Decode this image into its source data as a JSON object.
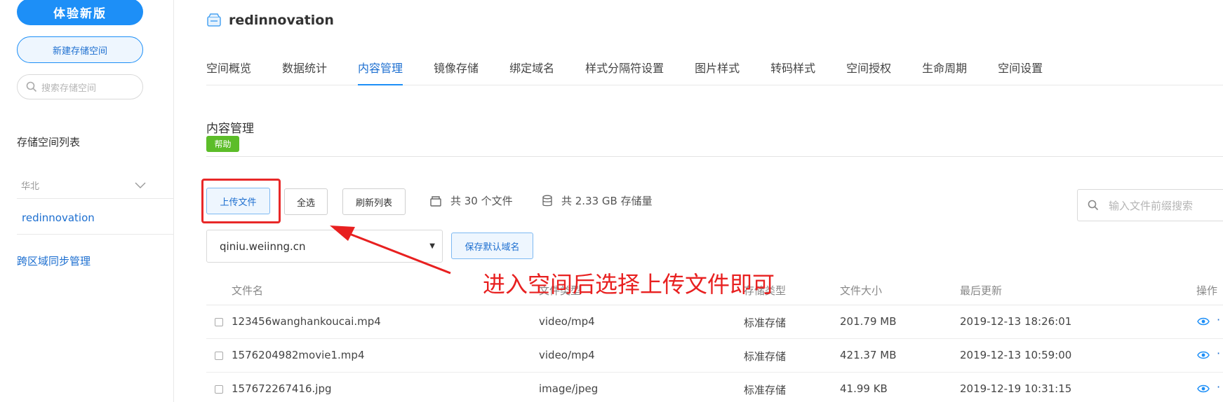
{
  "colors": {
    "primary": "#1d8ff7",
    "link": "#1d6fd0",
    "help": "#5cbd29",
    "annotation": "#e82020"
  },
  "sidebar": {
    "new_version": "体验新版",
    "new_space": "新建存储空间",
    "search_placeholder": "搜索存储空间",
    "list_title": "存储空间列表",
    "region": "华北",
    "space": "redinnovation",
    "sync": "跨区域同步管理"
  },
  "header": {
    "bucket_name": "redinnovation"
  },
  "tabs": [
    "空间概览",
    "数据统计",
    "内容管理",
    "镜像存储",
    "绑定域名",
    "样式分隔符设置",
    "图片样式",
    "转码样式",
    "空间授权",
    "生命周期",
    "空间设置"
  ],
  "active_tab": "内容管理",
  "content": {
    "title": "内容管理",
    "help": "帮助",
    "upload": "上传文件",
    "select_all": "全选",
    "refresh": "刷新列表",
    "file_count": "共 30 个文件",
    "storage": "共 2.33 GB 存储量",
    "search_placeholder": "输入文件前缀搜索",
    "domain": "qiniu.weiinng.cn",
    "save_domain": "保存默认域名",
    "annotation": "进入空间后选择上传文件即可"
  },
  "table": {
    "headers": [
      "文件名",
      "文件类型",
      "存储类型",
      "文件大小",
      "最后更新",
      "操作"
    ],
    "rows": [
      {
        "name": "123456wanghankoucai.mp4",
        "type": "video/mp4",
        "storage": "标准存储",
        "size": "201.79 MB",
        "updated": "2019-12-13 18:26:01"
      },
      {
        "name": "1576204982movie1.mp4",
        "type": "video/mp4",
        "storage": "标准存储",
        "size": "421.37 MB",
        "updated": "2019-12-13 10:59:00"
      },
      {
        "name": "157672267416.jpg",
        "type": "image/jpeg",
        "storage": "标准存储",
        "size": "41.99 KB",
        "updated": "2019-12-19 10:31:15"
      }
    ]
  }
}
